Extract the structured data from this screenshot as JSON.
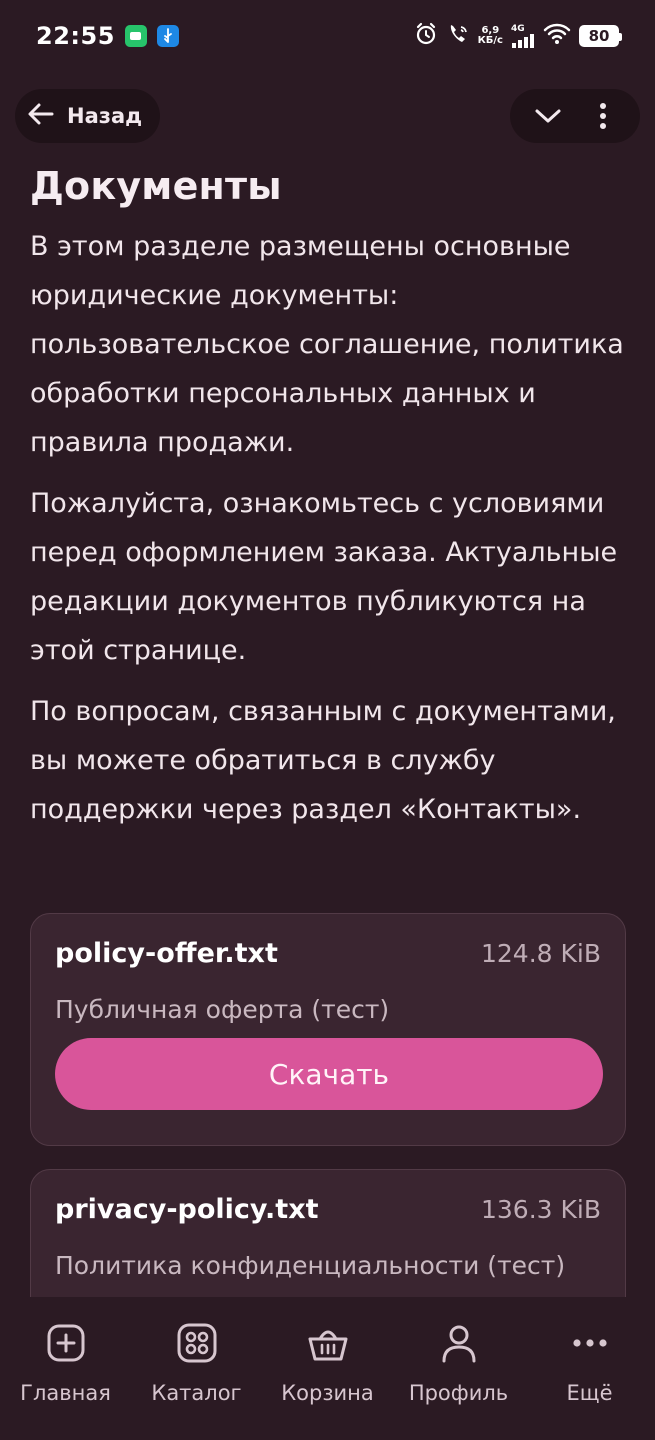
{
  "status_bar": {
    "time": "22:55",
    "net_speed_value": "6,9",
    "net_speed_unit": "КБ/с",
    "network_type": "4G",
    "battery": "80"
  },
  "top_nav": {
    "back_label": "Назад"
  },
  "page": {
    "title": "Документы",
    "paragraphs": [
      "В этом разделе размещены основные юридические документы: пользовательское соглашение, политика обработки персональных данных и правила продажи.",
      "Пожалуйста, ознакомьтесь с условиями перед оформлением заказа. Актуальные редакции документов публикуются на этой странице.",
      "По вопросам, связанным с документами, вы можете обратиться в службу поддержки через раздел «Контакты»."
    ]
  },
  "documents": [
    {
      "file_name": "policy-offer.txt",
      "size": "124.8 KiB",
      "description": "Публичная оферта (тест)",
      "download_label": "Скачать"
    },
    {
      "file_name": "privacy-policy.txt",
      "size": "136.3 KiB",
      "description": "Политика конфиденциальности (тест)"
    }
  ],
  "bottom_nav": {
    "items": [
      {
        "label": "Главная",
        "icon": "plus-square-icon"
      },
      {
        "label": "Каталог",
        "icon": "grid-icon"
      },
      {
        "label": "Корзина",
        "icon": "basket-icon"
      },
      {
        "label": "Профиль",
        "icon": "person-icon"
      },
      {
        "label": "Ещё",
        "icon": "more-horizontal-icon"
      }
    ]
  },
  "colors": {
    "background": "#2b1a23",
    "card": "#3a2530",
    "accent": "#d9559a"
  }
}
